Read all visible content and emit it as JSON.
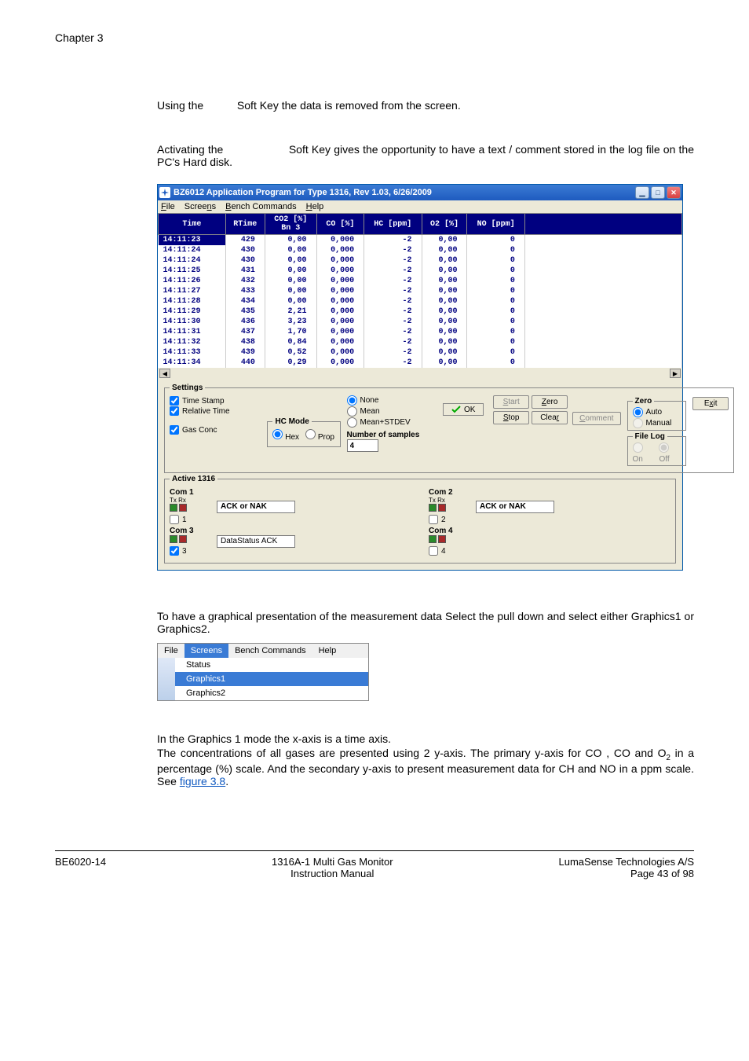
{
  "page": {
    "chapter": "Chapter 3",
    "para1": "Using the           Soft Key the data is removed from the screen.",
    "para2": "Activating the                    Soft Key gives the opportunity to have a text / comment stored in the log file on the PC's Hard disk.",
    "para3": "To have a graphical presentation of the measurement data Select the pull down and select either Graphics1 or Graphics2.",
    "para4_a": "In the Graphics 1 mode the x-axis is a time axis.",
    "para4_b_before": "The concentrations of all gases are presented using 2 y-axis. The primary y-axis for CO , CO and O",
    "para4_b_sub": "2",
    "para4_b_mid": " in a percentage (%) scale. And the secondary y-axis to present measurement data for CH and NO in a ppm scale. See ",
    "figure_link": "figure 3.8",
    "para4_b_after": "."
  },
  "app": {
    "title": "BZ6012 Application Program for Type 1316, Rev 1.03, 6/26/2009",
    "menu": {
      "file": "File",
      "screens": "Screens",
      "bench": "Bench Commands",
      "help": "Help"
    },
    "headers": [
      "Time",
      "RTime",
      "CO2 [%]",
      "CO [%]",
      "HC [ppm]",
      "O2 [%]",
      "NO [ppm]"
    ],
    "sub_header": "Bn 3",
    "rows": [
      {
        "t": "14:11:23",
        "r": "429",
        "co2": "0,00",
        "co": "0,000",
        "hc": "-2",
        "o2": "0,00",
        "no": "0",
        "hl": true
      },
      {
        "t": "14:11:24",
        "r": "430",
        "co2": "0,00",
        "co": "0,000",
        "hc": "-2",
        "o2": "0,00",
        "no": "0"
      },
      {
        "t": "14:11:24",
        "r": "430",
        "co2": "0,00",
        "co": "0,000",
        "hc": "-2",
        "o2": "0,00",
        "no": "0"
      },
      {
        "t": "14:11:25",
        "r": "431",
        "co2": "0,00",
        "co": "0,000",
        "hc": "-2",
        "o2": "0,00",
        "no": "0"
      },
      {
        "t": "14:11:26",
        "r": "432",
        "co2": "0,00",
        "co": "0,000",
        "hc": "-2",
        "o2": "0,00",
        "no": "0"
      },
      {
        "t": "14:11:27",
        "r": "433",
        "co2": "0,00",
        "co": "0,000",
        "hc": "-2",
        "o2": "0,00",
        "no": "0"
      },
      {
        "t": "14:11:28",
        "r": "434",
        "co2": "0,00",
        "co": "0,000",
        "hc": "-2",
        "o2": "0,00",
        "no": "0"
      },
      {
        "t": "14:11:29",
        "r": "435",
        "co2": "2,21",
        "co": "0,000",
        "hc": "-2",
        "o2": "0,00",
        "no": "0"
      },
      {
        "t": "14:11:30",
        "r": "436",
        "co2": "3,23",
        "co": "0,000",
        "hc": "-2",
        "o2": "0,00",
        "no": "0"
      },
      {
        "t": "14:11:31",
        "r": "437",
        "co2": "1,70",
        "co": "0,000",
        "hc": "-2",
        "o2": "0,00",
        "no": "0"
      },
      {
        "t": "14:11:32",
        "r": "438",
        "co2": "0,84",
        "co": "0,000",
        "hc": "-2",
        "o2": "0,00",
        "no": "0"
      },
      {
        "t": "14:11:33",
        "r": "439",
        "co2": "0,52",
        "co": "0,000",
        "hc": "-2",
        "o2": "0,00",
        "no": "0"
      },
      {
        "t": "14:11:34",
        "r": "440",
        "co2": "0,29",
        "co": "0,000",
        "hc": "-2",
        "o2": "0,00",
        "no": "0"
      }
    ],
    "settings": {
      "legend": "Settings",
      "time_stamp": "Time Stamp",
      "relative_time": "Relative Time",
      "gas_conc": "Gas Conc",
      "hc_mode": "HC Mode",
      "hex": "Hex",
      "prop": "Prop",
      "stat_none": "None",
      "stat_mean": "Mean",
      "stat_meanstdev": "Mean+STDEV",
      "num_samples_label": "Number of samples",
      "num_samples": "4",
      "ok": "OK",
      "start": "Start",
      "stop": "Stop",
      "zerob": "Zero",
      "clear": "Clear",
      "comment": "Comment",
      "exit": "Exit",
      "zero_legend": "Zero",
      "auto": "Auto",
      "manual": "Manual",
      "filelog_legend": "File Log",
      "on": "On",
      "off": "Off"
    },
    "active": {
      "legend": "Active 1316",
      "com1": "Com 1",
      "com2": "Com 2",
      "com3": "Com 3",
      "com4": "Com 4",
      "txrx": "Tx Rx",
      "ack_or_nak": "ACK or NAK",
      "datastatus": "DataStatus  ACK",
      "one": "1",
      "two": "2",
      "three": "3",
      "four": "4"
    }
  },
  "menu_shot": {
    "file": "File",
    "screens": "Screens",
    "bench": "Bench Commands",
    "help": "Help",
    "status": "Status",
    "g1": "Graphics1",
    "g2": "Graphics2"
  },
  "footer": {
    "left": "BE6020-14",
    "center1": "1316A-1 Multi Gas Monitor",
    "center2": "Instruction Manual",
    "right1": "LumaSense Technologies A/S",
    "right2": "Page 43 of 98"
  }
}
